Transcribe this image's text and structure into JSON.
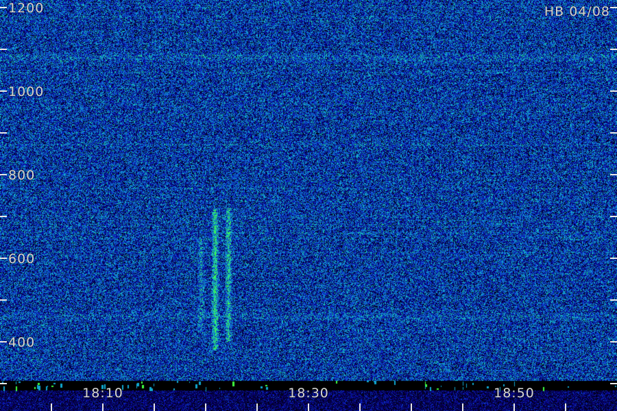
{
  "chart_data": {
    "type": "heatmap",
    "title": "",
    "station_date": "HB 04/08",
    "xlabel": "",
    "ylabel": "",
    "y_axis": {
      "range": [
        330,
        1200
      ],
      "tick_labels": [
        {
          "value": 1200,
          "label": "1200"
        },
        {
          "value": 1000,
          "label": "1000"
        },
        {
          "value": 800,
          "label": "800"
        },
        {
          "value": 600,
          "label": "600"
        },
        {
          "value": 400,
          "label": "400"
        }
      ],
      "minor_ticks": [
        1100,
        900,
        700,
        500,
        300
      ]
    },
    "x_axis": {
      "range": [
        "18:00",
        "19:00"
      ],
      "range_minutes": [
        0,
        60
      ],
      "tick_labels": [
        {
          "minute": 10,
          "label": "18:10"
        },
        {
          "minute": 30,
          "label": "18:30"
        },
        {
          "minute": 50,
          "label": "18:50"
        }
      ],
      "minor_ticks_minutes": [
        5,
        15,
        20,
        25,
        35,
        40,
        45,
        55
      ]
    },
    "colormap": [
      "#000000",
      "#08007a",
      "#0a18c8",
      "#1060d8",
      "#10a8d0",
      "#20e0a0",
      "#40ff40"
    ],
    "features": [
      {
        "kind": "vertical-burst",
        "minute": 20.9,
        "freq_range": [
          380,
          720
        ],
        "intensity": 0.85
      },
      {
        "kind": "vertical-burst",
        "minute": 22.2,
        "freq_range": [
          400,
          720
        ],
        "intensity": 0.7
      },
      {
        "kind": "vertical-burst",
        "minute": 19.5,
        "freq_range": [
          420,
          650
        ],
        "intensity": 0.35
      },
      {
        "kind": "horizontal-band",
        "freq": 1080,
        "intensity": 0.5
      },
      {
        "kind": "horizontal-band",
        "freq": 460,
        "intensity": 0.4
      }
    ],
    "grid": false,
    "legend": "none"
  }
}
